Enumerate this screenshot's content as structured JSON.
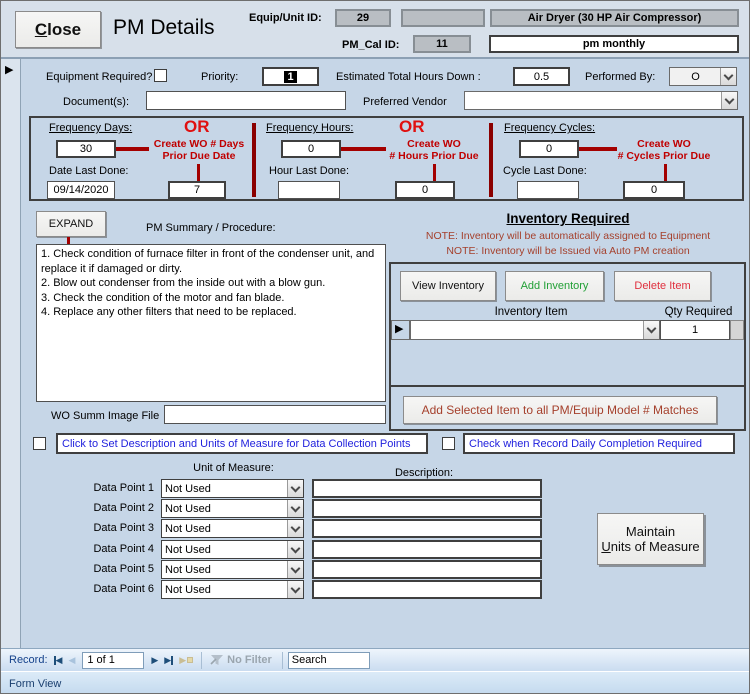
{
  "header": {
    "close_label": "Close",
    "title": "PM Details",
    "equip_unit_id_label": "Equip/Unit ID:",
    "equip_unit_id": "29",
    "equip_blank": "",
    "equip_name": "Air Dryer (30 HP Air Compressor)",
    "pm_cal_id_label": "PM_Cal ID:",
    "pm_cal_id": "11",
    "pm_name": "pm monthly"
  },
  "controls": {
    "equipment_required_label": "Equipment Required?",
    "priority_label": "Priority:",
    "priority_value": "1",
    "est_hours_label": "Estimated Total Hours Down :",
    "est_hours_value": "0.5",
    "performed_by_label": "Performed By:",
    "performed_by_value": "O",
    "documents_label": "Document(s):",
    "documents_value": "",
    "preferred_vendor_label": "Preferred Vendor",
    "preferred_vendor_value": ""
  },
  "frequency": {
    "days": {
      "label": "Frequency Days:",
      "value": "30",
      "or": "OR",
      "create_wo1": "Create WO # Days",
      "create_wo2": "Prior Due Date",
      "last_label": "Date Last Done:",
      "last_value": "09/14/2020",
      "prior_value": "7"
    },
    "hours": {
      "label": "Frequency Hours:",
      "value": "0",
      "or": "OR",
      "create_wo1": "Create WO",
      "create_wo2": "# Hours Prior Due",
      "last_label": "Hour Last Done:",
      "last_value": "",
      "prior_value": "0"
    },
    "cycles": {
      "label": "Frequency Cycles:",
      "value": "0",
      "create_wo1": "Create WO",
      "create_wo2": "# Cycles Prior Due",
      "last_label": "Cycle Last Done:",
      "last_value": "",
      "prior_value": "0"
    }
  },
  "summary": {
    "expand_label": "EXPAND",
    "label": "PM Summary / Procedure:",
    "text": "1.  Check condition of furnace filter in front of the condenser unit, and replace it if damaged or dirty.\n2.  Blow out condenser from the inside out with a blow gun.\n3.  Check the condition of the motor and fan blade.\n4.  Replace any other filters that need to be replaced.",
    "wo_summ_label": "WO Summ Image File",
    "wo_summ_value": ""
  },
  "inventory": {
    "title": "Inventory Required",
    "note1": "NOTE: Inventory will be automatically assigned to Equipment",
    "note2": "NOTE: Inventory will be Issued via Auto PM creation",
    "view_btn": "View Inventory",
    "add_btn": "Add Inventory",
    "delete_btn": "Delete Item",
    "col_item": "Inventory Item",
    "col_qty": "Qty Required",
    "row_item_value": "",
    "row_qty_value": "1",
    "add_selected_btn": "Add Selected Item to all PM/Equip Model # Matches"
  },
  "data_collection": {
    "set_desc_label": "Click to Set Description and Units of Measure for Data Collection Points",
    "daily_label": "Check when Record Daily Completion Required",
    "uom_header": "Unit of Measure:",
    "desc_header": "Description:",
    "points": [
      {
        "label": "Data Point 1",
        "uom": "Not Used",
        "desc": ""
      },
      {
        "label": "Data Point 2",
        "uom": "Not Used",
        "desc": ""
      },
      {
        "label": "Data Point 3",
        "uom": "Not Used",
        "desc": ""
      },
      {
        "label": "Data Point 4",
        "uom": "Not Used",
        "desc": ""
      },
      {
        "label": "Data Point 5",
        "uom": "Not Used",
        "desc": ""
      },
      {
        "label": "Data Point 6",
        "uom": "Not Used",
        "desc": ""
      }
    ],
    "maintain_btn_line1": "Maintain",
    "maintain_btn_line2": "Units of Measure"
  },
  "record_bar": {
    "record_label": "Record:",
    "position": "1 of 1",
    "no_filter_label": "No Filter",
    "search_value": "Search"
  },
  "status_bar": {
    "view_label": "Form View"
  },
  "colors": {
    "form_bg": "#c6d6e7",
    "or_red": "#e01010",
    "connector_red": "#a40000",
    "note_brown": "#a5402c",
    "link_blue": "#2121dd",
    "add_green": "#22a036",
    "delete_red": "#e0303e"
  }
}
